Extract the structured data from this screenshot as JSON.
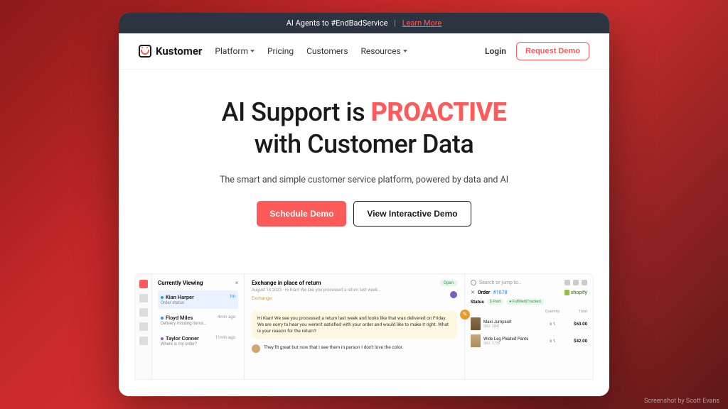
{
  "banner": {
    "text": "AI Agents to #EndBadService",
    "link": "Learn More"
  },
  "nav": {
    "brand": "Kustomer",
    "items": [
      "Platform",
      "Pricing",
      "Customers",
      "Resources"
    ],
    "login": "Login",
    "request_demo": "Request Demo"
  },
  "hero": {
    "line1_a": "AI Support is ",
    "line1_b": "PROACTIVE",
    "line2": "with Customer Data",
    "subtitle": "The smart and simple customer service platform, powered by data and AI",
    "cta_primary": "Schedule Demo",
    "cta_secondary": "View Interactive Demo"
  },
  "preview": {
    "list": {
      "header": "Currently Viewing",
      "close": "×",
      "items": [
        {
          "name": "Kian Harper",
          "sub": "Order status",
          "status": "1m"
        },
        {
          "name": "Floyd Miles",
          "sub": "Delivery missing items…",
          "time": "4min ago"
        },
        {
          "name": "Taylor Conner",
          "sub": "Where is my order?",
          "time": "11min ago"
        }
      ]
    },
    "thread": {
      "title": "Exchange in place of return",
      "meta": "August 18 2023  ·  Hi Kian! We see you processed a return last week…",
      "badge": "Open",
      "tag": "Exchange",
      "msg1": "Hi Kian! We see you processed a return last week and looks like that was delivered on Friday. We are sorry to hear you weren't satisfied with your order and would like to make it right. What is your reason for the return?",
      "msg2": "They fit great but now that I see them in person I don't love the color."
    },
    "right": {
      "search": "Search or jump to…",
      "order_label": "Order",
      "order_number": "#1078",
      "shopify": "shopify",
      "status_label": "Status",
      "paid": "$ Paid",
      "fulfilled": "● Fulfilled|Tracked",
      "headers": [
        "",
        "Quantity",
        "Total"
      ],
      "products": [
        {
          "name": "Maxi Jumpsuit",
          "sku": "SKU: 2841",
          "qty": "x 1",
          "total": "$63.00"
        },
        {
          "name": "Wide Leg Pleated Pants",
          "sku": "SKU: 3778",
          "qty": "x 1",
          "total": "$42.00"
        }
      ]
    }
  },
  "credit": "Screenshot by Scott Evans"
}
